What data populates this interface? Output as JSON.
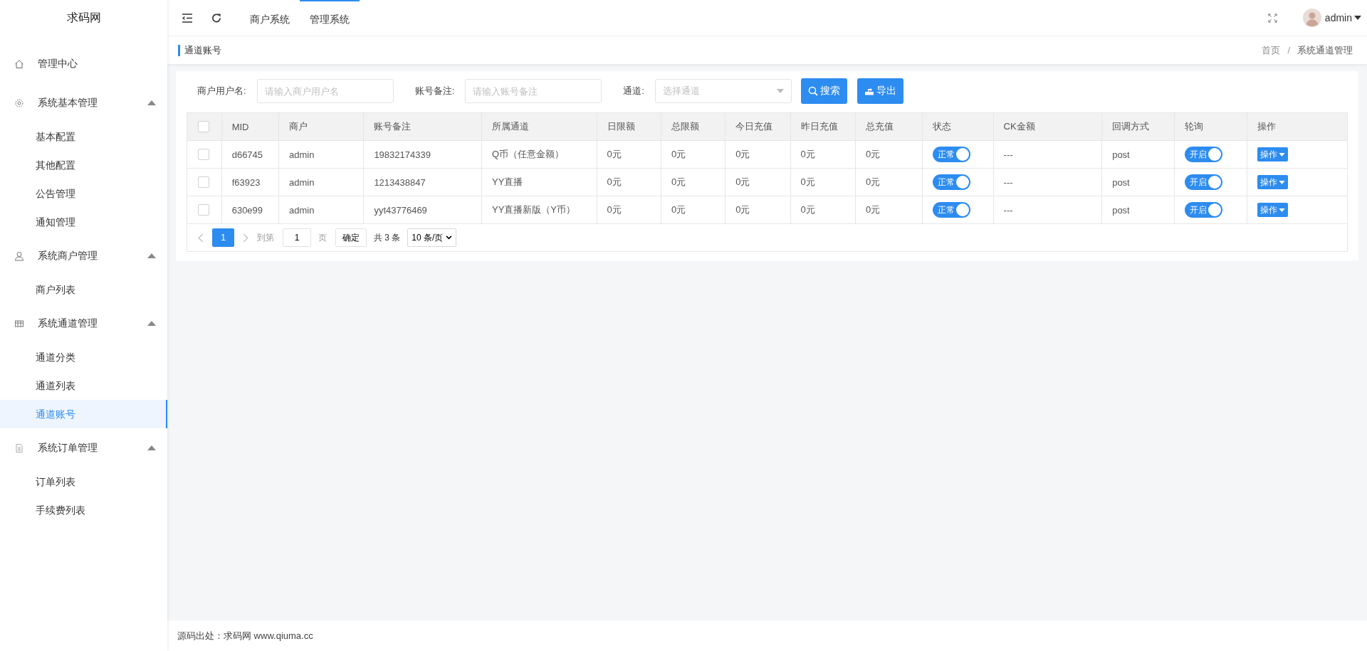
{
  "logo": "求码网",
  "sidebar": {
    "items": [
      {
        "label": "管理中心",
        "selected": false
      },
      {
        "label": "系统基本管理",
        "expanded": true,
        "children": [
          {
            "label": "基本配置",
            "selected": false
          },
          {
            "label": "其他配置",
            "selected": false
          },
          {
            "label": "公告管理",
            "selected": false
          },
          {
            "label": "通知管理",
            "selected": false
          }
        ]
      },
      {
        "label": "系统商户管理",
        "expanded": true,
        "children": [
          {
            "label": "商户列表",
            "selected": false
          }
        ]
      },
      {
        "label": "系统通道管理",
        "expanded": true,
        "children": [
          {
            "label": "通道分类",
            "selected": false
          },
          {
            "label": "通道列表",
            "selected": false
          },
          {
            "label": "通道账号",
            "selected": true
          }
        ]
      },
      {
        "label": "系统订单管理",
        "expanded": true,
        "children": [
          {
            "label": "订单列表",
            "selected": false
          },
          {
            "label": "手续费列表",
            "selected": false
          }
        ]
      }
    ]
  },
  "topbar": {
    "tabs": [
      {
        "label": "商户系统",
        "selected": false
      },
      {
        "label": "管理系统",
        "selected": true
      }
    ],
    "user": "admin"
  },
  "page_title": "通道账号",
  "breadcrumb": {
    "items": [
      "首页",
      "系统通道管理"
    ],
    "separator": "/"
  },
  "filters": [
    {
      "kind": "input",
      "label": "商户用户名:",
      "placeholder": "请输入商户用户名"
    },
    {
      "kind": "input",
      "label": "账号备注:",
      "placeholder": "请输入账号备注"
    },
    {
      "kind": "select",
      "label": "通道:",
      "placeholder": "选择通道"
    }
  ],
  "buttons": [
    {
      "label": "搜索"
    },
    {
      "label": "导出"
    }
  ],
  "table": {
    "select_all_checked": false,
    "columns": [
      "MID",
      "商户",
      "账号备注",
      "所属通道",
      "日限额",
      "总限额",
      "今日充值",
      "昨日充值",
      "总充值",
      "状态",
      "CK金额",
      "回调方式",
      "轮询",
      "操作"
    ],
    "rows": [
      {
        "checked": false,
        "cells": [
          "d66745",
          "admin",
          "19832174339",
          "Q币（任意金额）",
          "0元",
          "0元",
          "0元",
          "0元",
          "0元"
        ],
        "status": {
          "label": "正常",
          "on": true
        },
        "ck": "---",
        "callback": "post",
        "poll": {
          "label": "开启",
          "on": true
        },
        "action": "操作"
      },
      {
        "checked": false,
        "cells": [
          "f63923",
          "admin",
          "1213438847",
          "YY直播",
          "0元",
          "0元",
          "0元",
          "0元",
          "0元"
        ],
        "status": {
          "label": "正常",
          "on": true
        },
        "ck": "---",
        "callback": "post",
        "poll": {
          "label": "开启",
          "on": true
        },
        "action": "操作"
      },
      {
        "checked": false,
        "cells": [
          "630e99",
          "admin",
          "yyt43776469",
          "YY直播新版（Y币）",
          "0元",
          "0元",
          "0元",
          "0元",
          "0元"
        ],
        "status": {
          "label": "正常",
          "on": true
        },
        "ck": "---",
        "callback": "post",
        "poll": {
          "label": "开启",
          "on": true
        },
        "action": "操作"
      }
    ]
  },
  "pager": {
    "pages": [
      {
        "label": "1",
        "selected": true
      }
    ],
    "goto_label": "到第",
    "goto_value": "1",
    "page_unit": "页",
    "confirm": "确定",
    "total": "共 3 条",
    "page_size": "10 条/页"
  },
  "footer": "源码出处：求码网 www.qiuma.cc"
}
